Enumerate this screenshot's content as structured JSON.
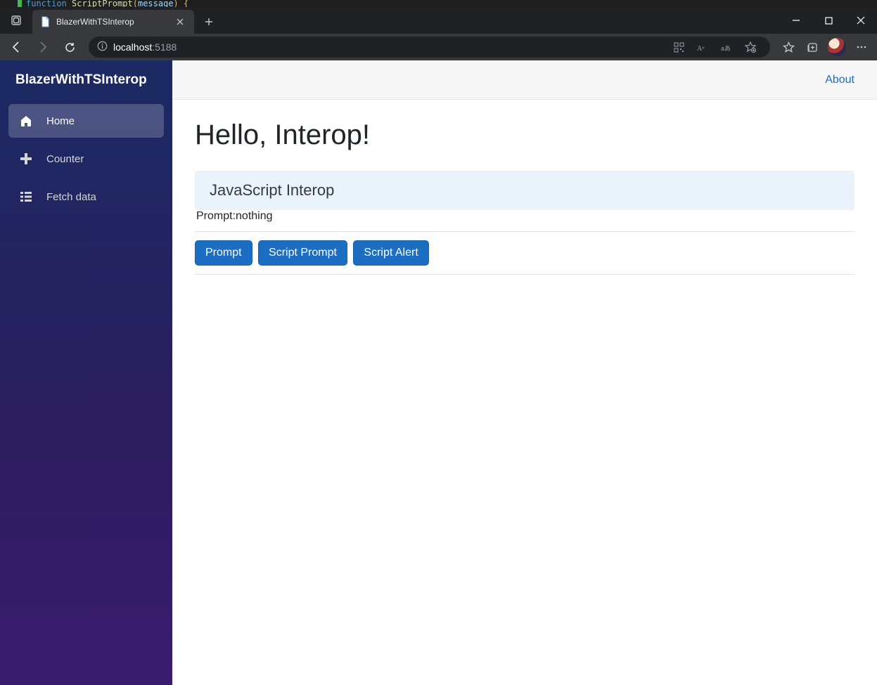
{
  "code_peek": {
    "kw": "function",
    "fn": "ScriptPrompt",
    "param": "message"
  },
  "browser": {
    "tab_title": "BlazerWithTSInterop",
    "url_host": "localhost",
    "url_port": ":5188"
  },
  "sidebar": {
    "brand": "BlazerWithTSInterop",
    "items": [
      {
        "label": "Home",
        "icon": "home-icon",
        "active": true
      },
      {
        "label": "Counter",
        "icon": "plus-icon",
        "active": false
      },
      {
        "label": "Fetch data",
        "icon": "list-icon",
        "active": false
      }
    ]
  },
  "topbar": {
    "about_label": "About"
  },
  "content": {
    "heading": "Hello, Interop!",
    "card_header": "JavaScript Interop",
    "prompt_label": "Prompt:",
    "prompt_value": "nothing",
    "buttons": {
      "prompt": "Prompt",
      "script_prompt": "Script Prompt",
      "script_alert": "Script Alert"
    }
  }
}
